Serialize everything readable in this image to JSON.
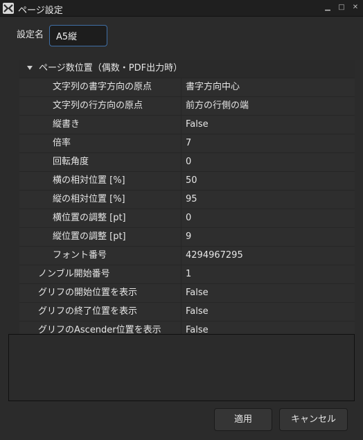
{
  "window": {
    "title": "ページ設定"
  },
  "name_field": {
    "label": "設定名",
    "value": "A5縦"
  },
  "tree": {
    "group": {
      "label": "ページ数位置（偶数・PDF出力時）",
      "rows": [
        {
          "key": "文字列の書字方向の原点",
          "value": "書字方向中心"
        },
        {
          "key": "文字列の行方向の原点",
          "value": "前方の行側の端"
        },
        {
          "key": "縦書き",
          "value": "False"
        },
        {
          "key": "倍率",
          "value": "7"
        },
        {
          "key": "回転角度",
          "value": "0"
        },
        {
          "key": "横の相対位置 [%]",
          "value": "50"
        },
        {
          "key": "縦の相対位置 [%]",
          "value": "95"
        },
        {
          "key": "横位置の調整 [pt]",
          "value": "0"
        },
        {
          "key": "縦位置の調整 [pt]",
          "value": "9"
        },
        {
          "key": "フォント番号",
          "value": "4294967295"
        }
      ]
    },
    "rows": [
      {
        "key": "ノンブル開始番号",
        "value": "1"
      },
      {
        "key": "グリフの開始位置を表示",
        "value": "False"
      },
      {
        "key": "グリフの終了位置を表示",
        "value": "False"
      },
      {
        "key": "グリフのAscender位置を表示",
        "value": "False"
      }
    ]
  },
  "buttons": {
    "apply": "適用",
    "cancel": "キャンセル"
  }
}
